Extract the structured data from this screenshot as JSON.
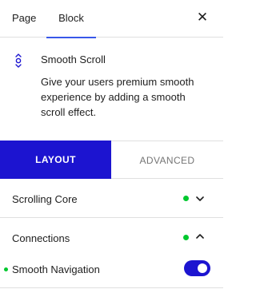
{
  "header": {
    "tabs": [
      {
        "label": "Page",
        "active": false
      },
      {
        "label": "Block",
        "active": true
      }
    ],
    "close_icon": "close-icon"
  },
  "block": {
    "icon": "smooth-scroll-icon",
    "title": "Smooth Scroll",
    "description": "Give your users premium smooth experience by adding a smooth scroll effect."
  },
  "segmented": {
    "layout_label": "LAYOUT",
    "advanced_label": "ADVANCED",
    "active": "LAYOUT"
  },
  "panels": {
    "scrolling_core": {
      "label": "Scrolling Core",
      "expanded": false
    },
    "connections": {
      "label": "Connections",
      "expanded": true
    }
  },
  "toggles": {
    "smooth_navigation": {
      "label": "Smooth Navigation",
      "enabled": true
    }
  },
  "colors": {
    "accent": "#1c14d0",
    "tab_indicator": "#3858e9",
    "status_dot": "#00c82e"
  }
}
